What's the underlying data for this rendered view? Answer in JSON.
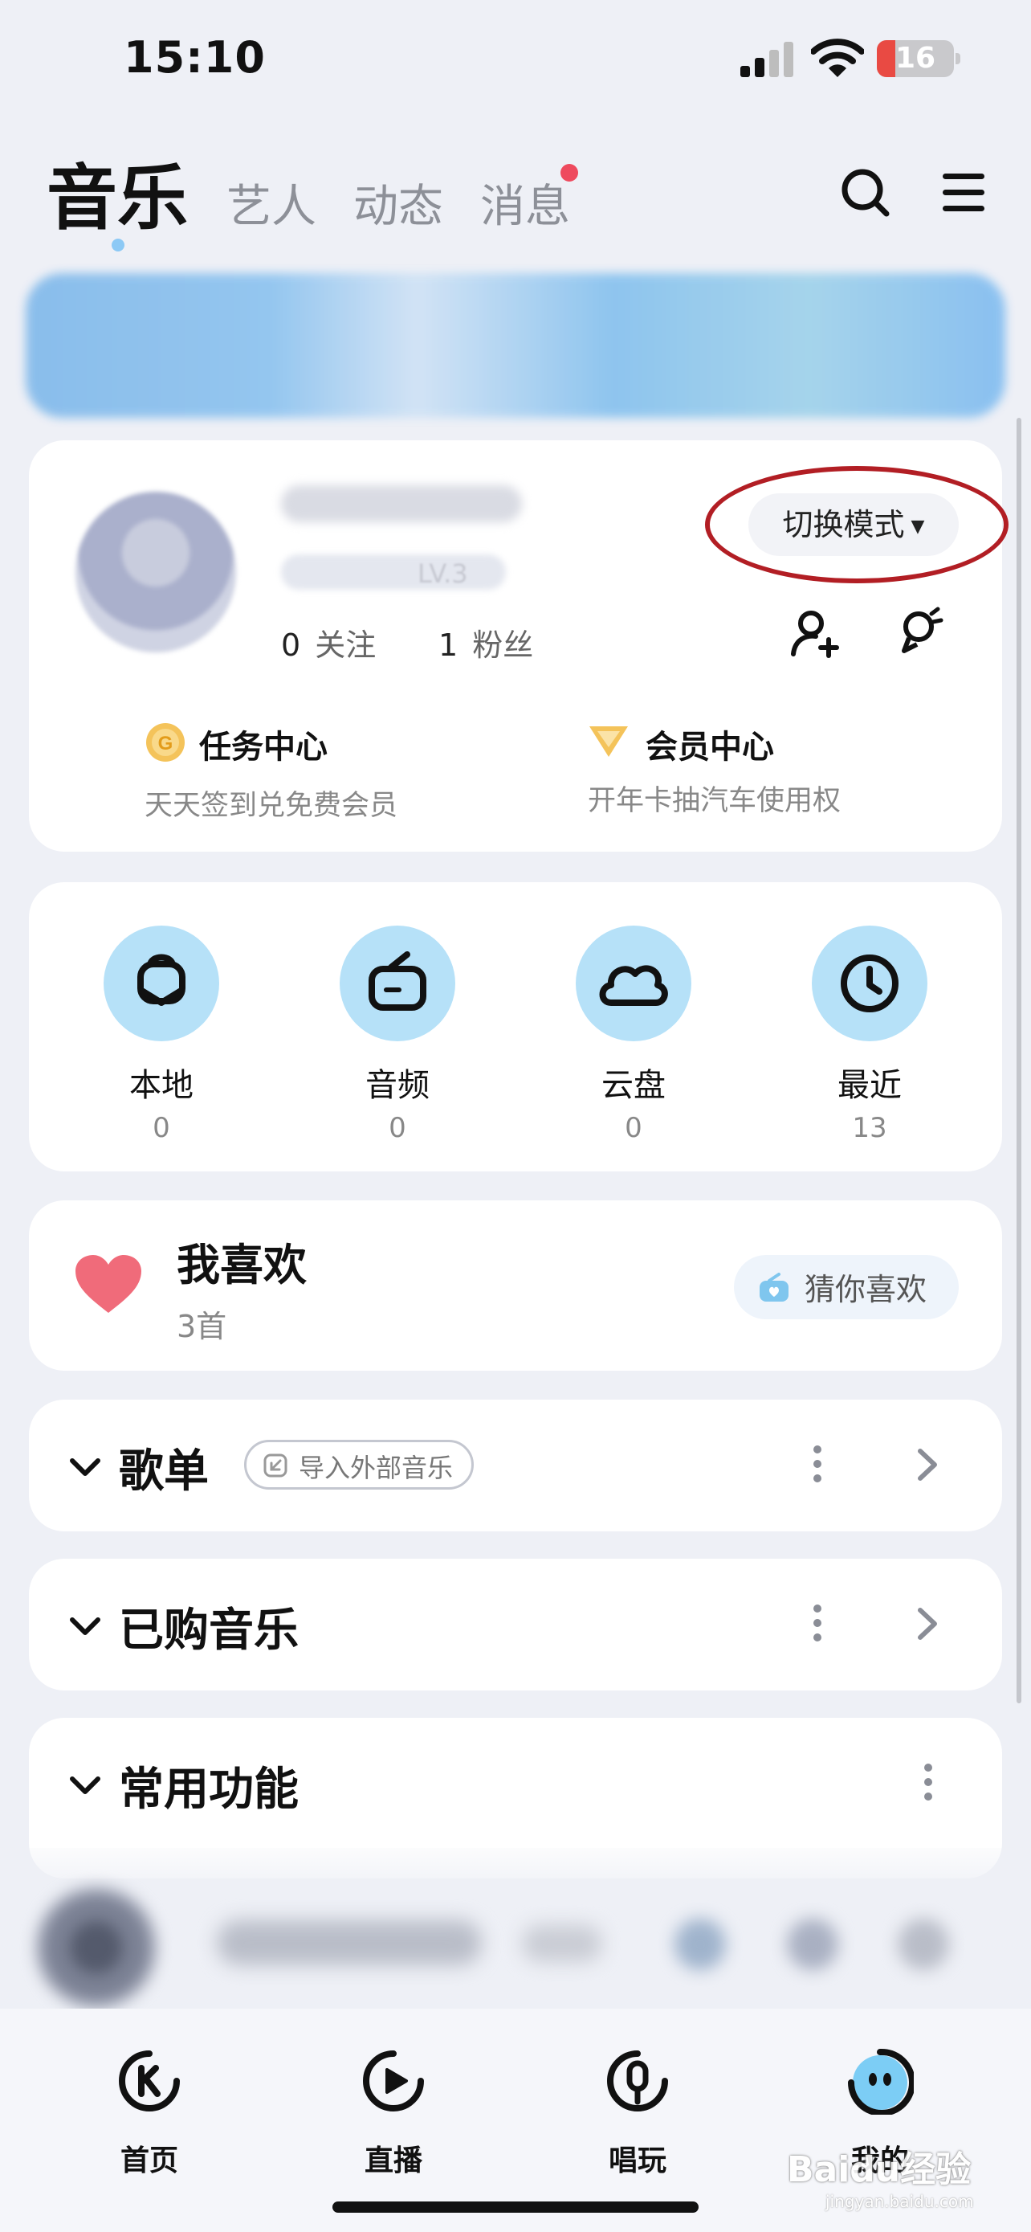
{
  "status_bar": {
    "time": "15:10",
    "battery_level": "16",
    "icons": [
      "cellular-signal-icon",
      "wifi-icon",
      "battery-icon"
    ]
  },
  "top_tabs": [
    {
      "label": "音乐",
      "active": true
    },
    {
      "label": "艺人",
      "active": false
    },
    {
      "label": "动态",
      "active": false
    },
    {
      "label": "消息",
      "active": false,
      "badge": true
    }
  ],
  "header_icons": [
    "search-icon",
    "menu-icon"
  ],
  "profile": {
    "level": "LV.3",
    "follow_count": "0",
    "follow_label": "关注",
    "fans_count": "1",
    "fans_label": "粉丝",
    "switch_mode_label": "切换模式",
    "task_center": {
      "title": "任务中心",
      "subtitle": "天天签到兑免费会员"
    },
    "vip_center": {
      "title": "会员中心",
      "subtitle": "开年卡抽汽车使用权"
    }
  },
  "quick_access": [
    {
      "label": "本地",
      "count": "0",
      "icon": "local-music-icon"
    },
    {
      "label": "音频",
      "count": "0",
      "icon": "audio-radio-icon"
    },
    {
      "label": "云盘",
      "count": "0",
      "icon": "cloud-icon"
    },
    {
      "label": "最近",
      "count": "13",
      "icon": "clock-icon"
    }
  ],
  "favorites": {
    "title": "我喜欢",
    "count": "3首",
    "guess_label": "猜你喜欢"
  },
  "sections": {
    "playlist": {
      "title": "歌单",
      "import_label": "导入外部音乐"
    },
    "purchased": {
      "title": "已购音乐"
    },
    "common": {
      "title": "常用功能"
    }
  },
  "bottom_nav": [
    {
      "label": "首页",
      "icon": "home-k-icon"
    },
    {
      "label": "直播",
      "icon": "live-play-icon"
    },
    {
      "label": "唱玩",
      "icon": "sing-mic-icon"
    },
    {
      "label": "我的",
      "icon": "profile-face-icon",
      "active": true
    }
  ],
  "watermark": {
    "text": "Baidu经验",
    "sub": "jingyan.baidu.com"
  },
  "colors": {
    "accent_blue": "#b6e1f8",
    "heart_red": "#f06b7a",
    "badge_red": "#ee4a5e",
    "highlight_ring": "#b21e24"
  }
}
